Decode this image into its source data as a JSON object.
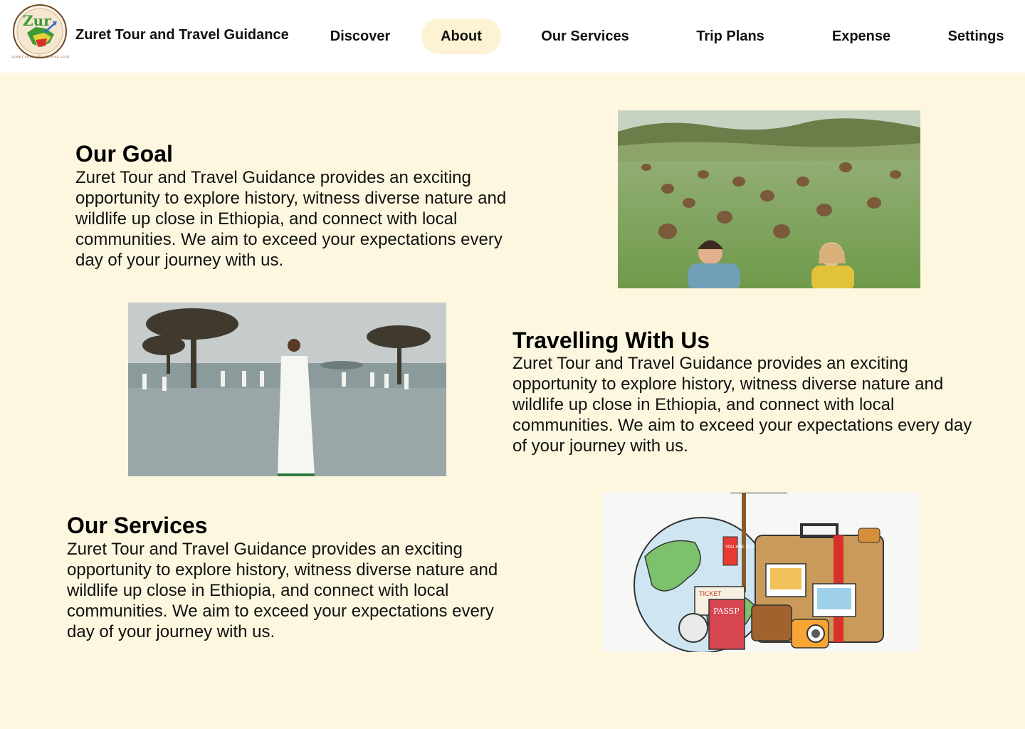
{
  "header": {
    "brand": "Zuret Tour and Travel Guidance",
    "logo_text": "Zur",
    "logo_tagline": "ZURET TOUR AND TRAVEL GUIDANCE",
    "nav": {
      "discover": "Discover",
      "about": "About",
      "services": "Our Services",
      "trip_plans": "Trip Plans",
      "expense": "Expense",
      "settings": "Settings"
    },
    "active": "About"
  },
  "sections": {
    "goal": {
      "title": "Our Goal",
      "body": "Zuret Tour and Travel Guidance provides an exciting opportunity to explore history, witness diverse nature and wildlife up close in Ethiopia, and connect with local communities. We aim to exceed your expectations every day of your journey with us."
    },
    "travelling": {
      "title": "Travelling With Us",
      "body": "Zuret Tour and Travel Guidance provides an exciting opportunity to explore history, witness diverse nature and wildlife up close in Ethiopia, and connect with local communities. We aim to exceed your expectations every day of your journey with us."
    },
    "services": {
      "title": "Our Services",
      "body": "Zuret Tour and Travel Guidance provides an exciting opportunity to explore history, witness diverse nature and wildlife up close in Ethiopia, and connect with local communities. We aim to exceed your expectations every day of your journey with us."
    }
  },
  "illustration": {
    "ticket": "TICKET",
    "passport": "PASSP",
    "you_are_here": "YOU ARE HERE"
  },
  "colors": {
    "page_background": "#fdf7df",
    "header_background": "#ffffff",
    "active_pill": "#fdf3d4",
    "text": "#111111"
  }
}
